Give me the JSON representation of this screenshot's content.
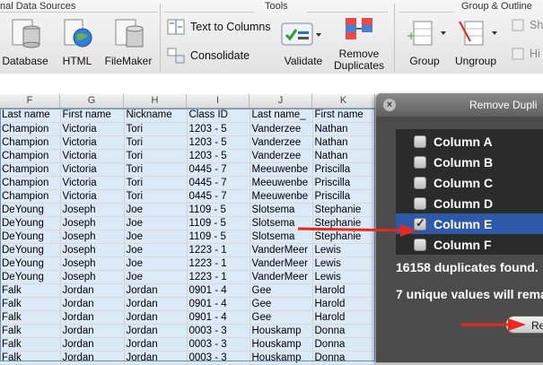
{
  "ribbon": {
    "groups": {
      "data_sources": "nal Data Sources",
      "tools": "Tools",
      "group_outline": "Group & Outline"
    },
    "buttons": {
      "database": "Database",
      "html": "HTML",
      "filemaker": "FileMaker",
      "text_to_columns": "Text to Columns",
      "consolidate": "Consolidate",
      "validate": "Validate",
      "remove_duplicates_1": "Remove",
      "remove_duplicates_2": "Duplicates",
      "group": "Group",
      "ungroup": "Ungroup",
      "show": "Sh",
      "hide": "Hi"
    }
  },
  "sheet": {
    "column_letters": [
      "F",
      "G",
      "H",
      "I",
      "J",
      "K"
    ],
    "headers": [
      "Last name",
      "First name",
      "Nickname",
      "Class ID",
      "Last name_",
      "First name"
    ],
    "rows": [
      [
        "Champion",
        "Victoria",
        "Tori",
        "1203 - 5",
        "Vanderzee",
        "Nathan"
      ],
      [
        "Champion",
        "Victoria",
        "Tori",
        "1203 - 5",
        "Vanderzee",
        "Nathan"
      ],
      [
        "Champion",
        "Victoria",
        "Tori",
        "1203 - 5",
        "Vanderzee",
        "Nathan"
      ],
      [
        "Champion",
        "Victoria",
        "Tori",
        "0445 - 7",
        "Meeuwenbe",
        "Priscilla"
      ],
      [
        "Champion",
        "Victoria",
        "Tori",
        "0445 - 7",
        "Meeuwenbe",
        "Priscilla"
      ],
      [
        "Champion",
        "Victoria",
        "Tori",
        "0445 - 7",
        "Meeuwenbe",
        "Priscilla"
      ],
      [
        "DeYoung",
        "Joseph",
        "Joe",
        "1109 - 5",
        "Slotsema",
        "Stephanie"
      ],
      [
        "DeYoung",
        "Joseph",
        "Joe",
        "1109 - 5",
        "Slotsema",
        "Stephanie"
      ],
      [
        "DeYoung",
        "Joseph",
        "Joe",
        "1109 - 5",
        "Slotsema",
        "Stephanie"
      ],
      [
        "DeYoung",
        "Joseph",
        "Joe",
        "1223 - 1",
        "VanderMeer",
        "Lewis"
      ],
      [
        "DeYoung",
        "Joseph",
        "Joe",
        "1223 - 1",
        "VanderMeer",
        "Lewis"
      ],
      [
        "DeYoung",
        "Joseph",
        "Joe",
        "1223 - 1",
        "VanderMeer",
        "Lewis"
      ],
      [
        "Falk",
        "Jordan",
        "Jordan",
        "0901 - 4",
        "Gee",
        "Harold"
      ],
      [
        "Falk",
        "Jordan",
        "Jordan",
        "0901 - 4",
        "Gee",
        "Harold"
      ],
      [
        "Falk",
        "Jordan",
        "Jordan",
        "0901 - 4",
        "Gee",
        "Harold"
      ],
      [
        "Falk",
        "Jordan",
        "Jordan",
        "0003 - 3",
        "Houskamp",
        "Donna"
      ],
      [
        "Falk",
        "Jordan",
        "Jordan",
        "0003 - 3",
        "Houskamp",
        "Donna"
      ],
      [
        "Falk",
        "Jordan",
        "Jordan",
        "0003 - 3",
        "Houskamp",
        "Donna"
      ]
    ]
  },
  "dialog": {
    "title": "Remove Dupli",
    "columns": [
      {
        "label": "Column A",
        "checked": false
      },
      {
        "label": "Column B",
        "checked": false
      },
      {
        "label": "Column C",
        "checked": false
      },
      {
        "label": "Column D",
        "checked": false
      },
      {
        "label": "Column E",
        "checked": true
      },
      {
        "label": "Column F",
        "checked": false
      }
    ],
    "duplicates_found": "16158 duplicates found.",
    "unique_values": "7 unique values will rema",
    "remove_button": "Re"
  },
  "colors": {
    "selection": "#dce9f7",
    "dialog_bg": "#4b4b4b",
    "highlight": "#2e59a9",
    "arrow": "#e8291c"
  }
}
